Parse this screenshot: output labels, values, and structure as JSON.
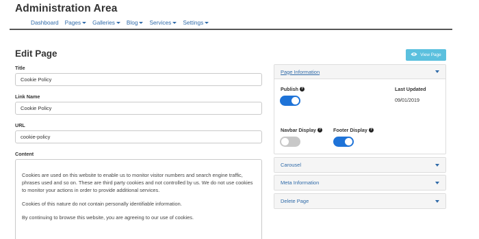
{
  "app": {
    "title": "Administration Area"
  },
  "nav": {
    "items": [
      {
        "label": "Dashboard",
        "dropdown": false
      },
      {
        "label": "Pages",
        "dropdown": true
      },
      {
        "label": "Galleries",
        "dropdown": true
      },
      {
        "label": "Blog",
        "dropdown": true
      },
      {
        "label": "Services",
        "dropdown": true
      },
      {
        "label": "Settings",
        "dropdown": true
      }
    ]
  },
  "page": {
    "title": "Edit Page"
  },
  "form": {
    "title": {
      "label": "Title",
      "value": "Cookie Policy"
    },
    "link_name": {
      "label": "Link Name",
      "value": "Cookie Policy"
    },
    "url": {
      "label": "URL",
      "value": "cookie-policy"
    },
    "content": {
      "label": "Content",
      "paragraphs": [
        "Cookies are used on this website to enable us to monitor visitor numbers and search engine traffic, phrases used and so on. These are third party cookies and not controlled by us. We do not use cookies to monitor your actions in order to provide additional services.",
        "Cookies of this nature do not contain personally identifiable information.",
        "By continuing to browse this website, you are agreeing to our use of cookies."
      ]
    }
  },
  "view_button": {
    "label": "View Page",
    "icon": "eye-icon"
  },
  "panels": {
    "page_information": {
      "title": "Page Information",
      "publish": {
        "label": "Publish",
        "on": true
      },
      "last_updated": {
        "label": "Last Updated",
        "value": "09/01/2019"
      },
      "navbar_display": {
        "label": "Navbar Display",
        "on": false
      },
      "footer_display": {
        "label": "Footer Display",
        "on": true
      }
    },
    "carousel": {
      "title": "Carousel"
    },
    "meta_information": {
      "title": "Meta Information"
    },
    "delete_page": {
      "title": "Delete Page"
    }
  },
  "colors": {
    "link": "#2f6aa8",
    "toggle_on": "#1e73d8",
    "toggle_off": "#c8c8c8",
    "view_button": "#5bc0de"
  }
}
